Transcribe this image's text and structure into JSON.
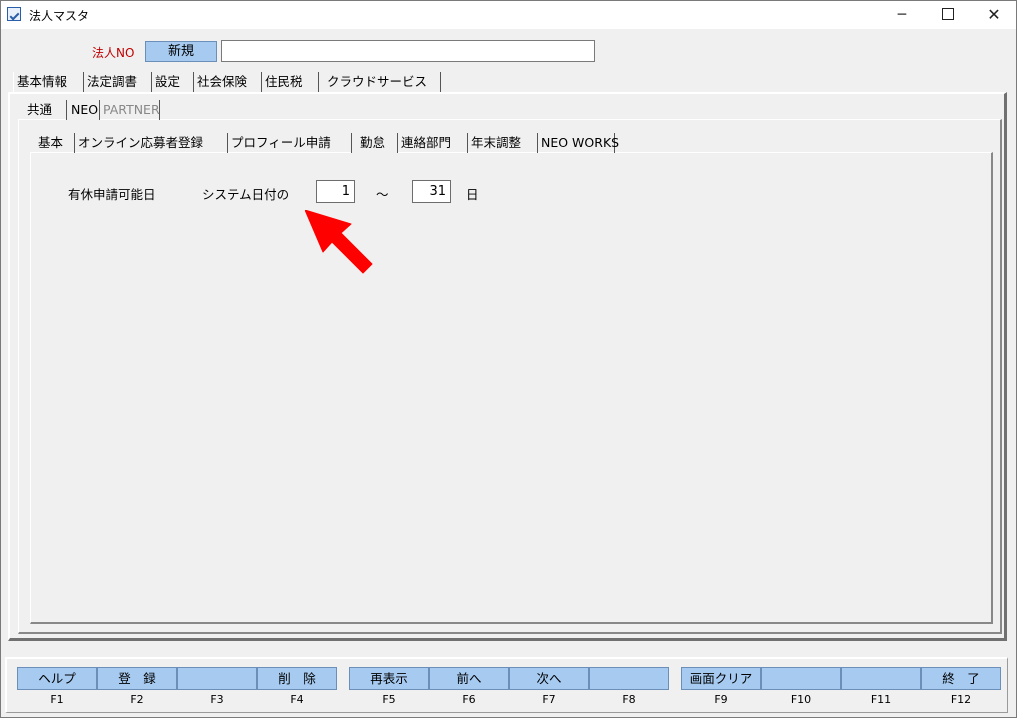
{
  "window": {
    "title": "法人マスタ",
    "minimize": "─",
    "close": "✕"
  },
  "header": {
    "hojin_no_label": "法人NO",
    "hojin_no_value": "新規",
    "hojin_name_value": ""
  },
  "tabs_main": [
    "基本情報",
    "法定調書",
    "設定",
    "社会保険",
    "住民税",
    "クラウドサービス"
  ],
  "tabs_sub": [
    "共通",
    "NEO",
    "PARTNER"
  ],
  "tabs_neo": [
    "基本",
    "オンライン応募者登録",
    "プロフィール申請",
    "勤怠",
    "連絡部門",
    "年末調整",
    "NEO WORKS"
  ],
  "form": {
    "label": "有休申請可能日",
    "prefix": "システム日付の",
    "from_value": "1",
    "tilde": "～",
    "to_value": "31",
    "suffix": "日"
  },
  "fkeys": [
    {
      "label": "ヘルプ",
      "key": "F1"
    },
    {
      "label": "登　録",
      "key": "F2"
    },
    {
      "label": "",
      "key": "F3"
    },
    {
      "label": "削　除",
      "key": "F4"
    },
    {
      "label": "再表示",
      "key": "F5"
    },
    {
      "label": "前へ",
      "key": "F6"
    },
    {
      "label": "次へ",
      "key": "F7"
    },
    {
      "label": "",
      "key": "F8"
    },
    {
      "label": "画面クリア",
      "key": "F9"
    },
    {
      "label": "",
      "key": "F10"
    },
    {
      "label": "",
      "key": "F11"
    },
    {
      "label": "終　了",
      "key": "F12"
    }
  ],
  "colors": {
    "button_blue": "#a6caf0",
    "red_label": "#c00000",
    "arrow_red": "#ff0000"
  }
}
